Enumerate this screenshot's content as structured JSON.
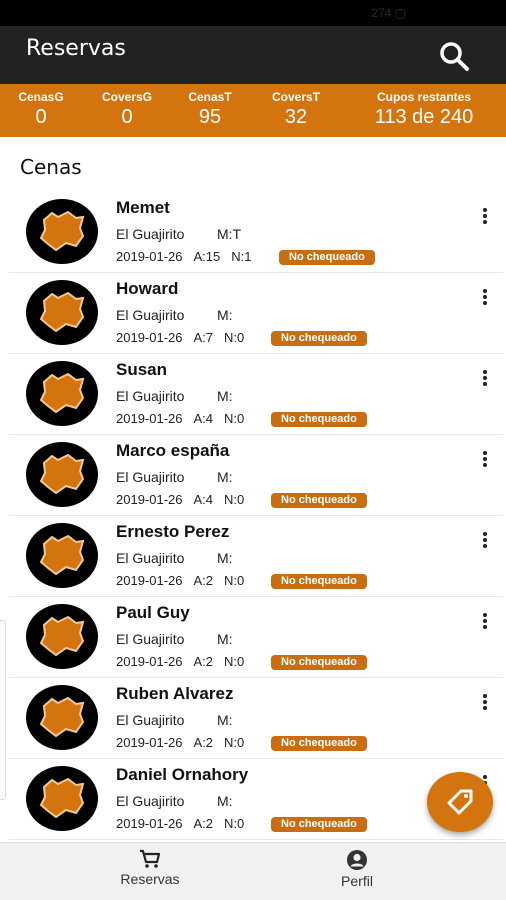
{
  "status_bar": {
    "text": "274 ▢"
  },
  "app_bar": {
    "title": "Reservas",
    "search_icon": "search-icon"
  },
  "stats": [
    {
      "label": "CenasG",
      "value": "0"
    },
    {
      "label": "CoversG",
      "value": "0"
    },
    {
      "label": "CenasT",
      "value": "95"
    },
    {
      "label": "CoversT",
      "value": "32"
    },
    {
      "label": "Cupos restantes",
      "value": "113 de 240"
    }
  ],
  "section": {
    "title": "Cenas"
  },
  "reservations": [
    {
      "name": "Memet",
      "place": "El Guajirito",
      "mesa": "M:T",
      "date": "2019-01-26",
      "a": "A:15",
      "n": "N:1",
      "status": "No chequeado"
    },
    {
      "name": "Howard",
      "place": "El Guajirito",
      "mesa": "M:",
      "date": "2019-01-26",
      "a": "A:7",
      "n": "N:0",
      "status": "No chequeado"
    },
    {
      "name": "Susan",
      "place": "El Guajirito",
      "mesa": "M:",
      "date": "2019-01-26",
      "a": "A:4",
      "n": "N:0",
      "status": "No chequeado"
    },
    {
      "name": "Marco españa",
      "place": "El Guajirito",
      "mesa": "M:",
      "date": "2019-01-26",
      "a": "A:4",
      "n": "N:0",
      "status": "No chequeado"
    },
    {
      "name": "Ernesto Perez",
      "place": "El Guajirito",
      "mesa": "M:",
      "date": "2019-01-26",
      "a": "A:2",
      "n": "N:0",
      "status": "No chequeado"
    },
    {
      "name": "Paul Guy",
      "place": "El Guajirito",
      "mesa": "M:",
      "date": "2019-01-26",
      "a": "A:2",
      "n": "N:0",
      "status": "No chequeado"
    },
    {
      "name": "Ruben Alvarez",
      "place": "El Guajirito",
      "mesa": "M:",
      "date": "2019-01-26",
      "a": "A:2",
      "n": "N:0",
      "status": "No chequeado"
    },
    {
      "name": "Daniel Ornahory",
      "place": "El Guajirito",
      "mesa": "M:",
      "date": "2019-01-26",
      "a": "A:2",
      "n": "N:0",
      "status": "No chequeado"
    }
  ],
  "fab": {
    "icon": "tag-icon"
  },
  "bottom_nav": [
    {
      "label": "Reservas",
      "icon": "cart-icon"
    },
    {
      "label": "Perfil",
      "icon": "account-icon"
    }
  ],
  "colors": {
    "accent": "#d4740e",
    "badge": "#c96d10",
    "app_bar": "#222222"
  }
}
